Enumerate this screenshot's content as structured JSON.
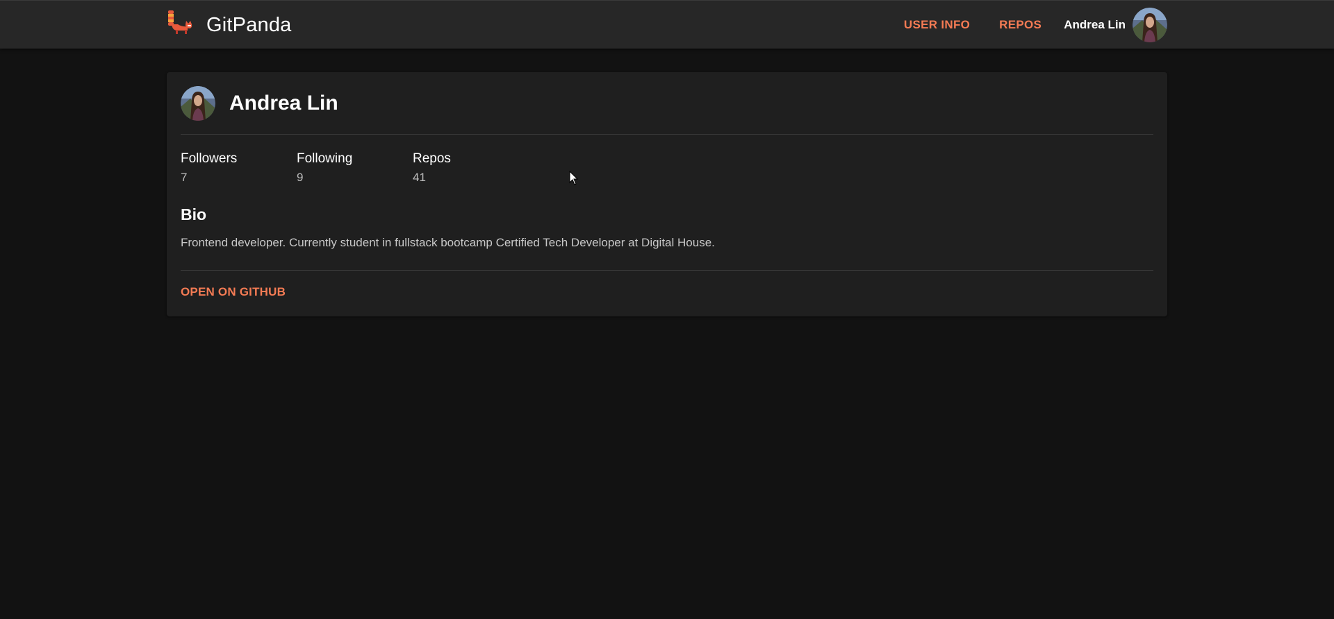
{
  "app": {
    "brand_name": "GitPanda",
    "logo_icon": "red-panda-logo-icon",
    "accent_color": "#f47b54"
  },
  "nav": {
    "items": [
      {
        "label": "USER INFO"
      },
      {
        "label": "REPOS"
      }
    ],
    "user_name": "Andrea Lin",
    "avatar_icon": "user-avatar"
  },
  "profile": {
    "name": "Andrea Lin",
    "stats": [
      {
        "label": "Followers",
        "value": "7"
      },
      {
        "label": "Following",
        "value": "9"
      },
      {
        "label": "Repos",
        "value": "41"
      }
    ],
    "bio_heading": "Bio",
    "bio": "Frontend developer. Currently student in fullstack bootcamp Certified Tech Developer at Digital House.",
    "action_label": "OPEN ON GITHUB"
  }
}
